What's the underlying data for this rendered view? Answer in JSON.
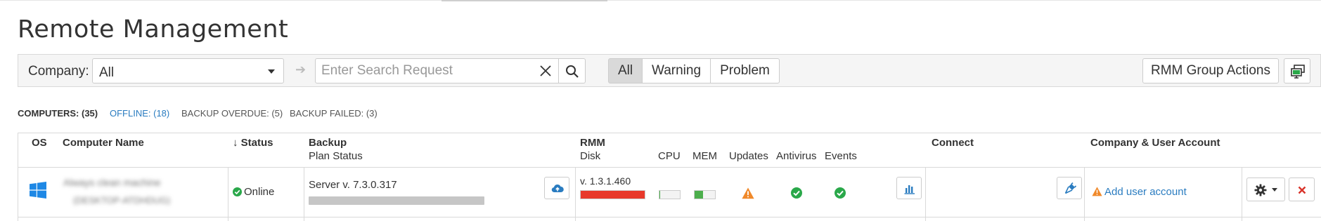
{
  "page": {
    "title": "Remote Management"
  },
  "toolbar": {
    "company_label": "Company:",
    "company_value": "All",
    "search_placeholder": "Enter Search Request",
    "segments": [
      "All",
      "Warning",
      "Problem"
    ],
    "active_segment": "All",
    "rmm_actions_label": "RMM Group Actions"
  },
  "filters": {
    "computers": "COMPUTERS: (35)",
    "offline": "OFFLINE: (18)",
    "backup_overdue": "BACKUP OVERDUE: (5)",
    "backup_failed": "BACKUP FAILED: (3)"
  },
  "table": {
    "headers": {
      "os": "OS",
      "computer_name": "Computer Name",
      "status": "Status",
      "status_sort": "↓",
      "backup": "Backup",
      "plan_status": "Plan Status",
      "rmm": "RMM",
      "disk": "Disk",
      "cpu": "CPU",
      "mem": "MEM",
      "updates": "Updates",
      "antivirus": "Antivirus",
      "events": "Events",
      "connect": "Connect",
      "company_account": "Company & User Account"
    },
    "row": {
      "os": "windows-icon",
      "name_line1": "Always clean machine",
      "name_line2": "(DESKTOP-ATDHDUG)",
      "status": "Online",
      "backup_version": "Server v. 7.3.0.317",
      "rmm_version": "v. 1.3.1.460",
      "disk_usage": 1.0,
      "cpu_usage": 0.05,
      "mem_usage": 0.4,
      "updates_icon": "warning-icon",
      "antivirus_icon": "check-circle-icon",
      "events_icon": "check-circle-icon",
      "account_link": "Add user account"
    }
  },
  "colors": {
    "link": "#2a7cc0",
    "ok_green": "#2aa84a",
    "warning_orange": "#f0892a",
    "danger_red": "#e8392b"
  }
}
